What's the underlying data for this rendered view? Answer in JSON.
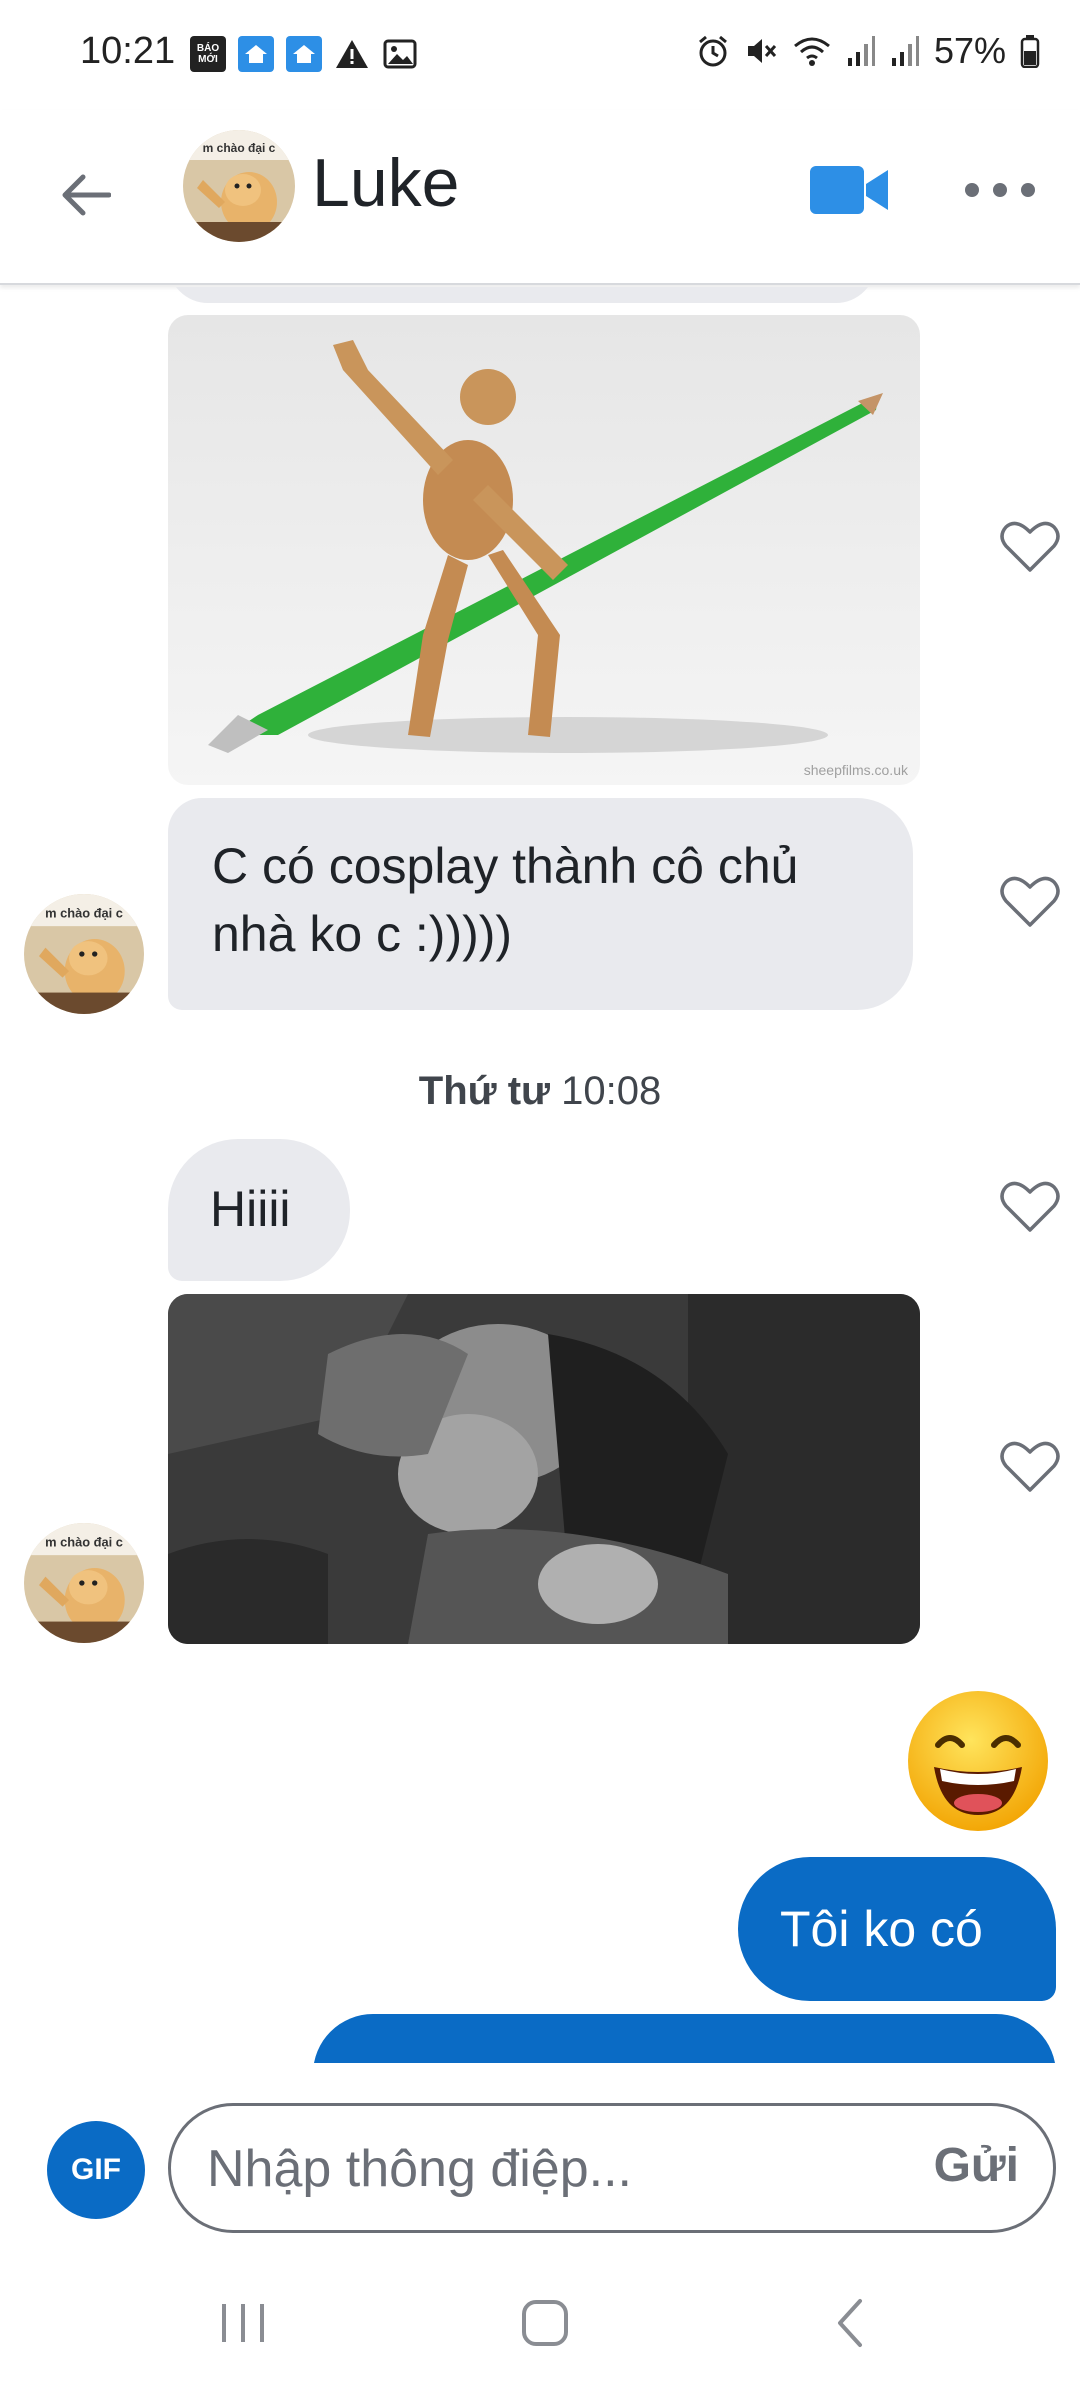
{
  "status_bar": {
    "time": "10:21",
    "baomoi_label": "BÁO MỚI",
    "battery": "57%",
    "icons": [
      "baomoi-app-icon",
      "home-notification-icon",
      "home-notification-icon",
      "warning-icon",
      "image-icon",
      "alarm-icon",
      "mute-icon",
      "wifi-icon",
      "signal-icon",
      "signal-icon",
      "battery-icon"
    ]
  },
  "header": {
    "contact_name": "Luke",
    "avatar_caption": "m chào đại c",
    "icons": [
      "back-arrow-icon",
      "video-call-icon",
      "more-icon"
    ]
  },
  "messages": {
    "msg1_text": "C có cosplay thành cô chủ nhà ko c :)))))",
    "timestamp_day": "Thứ tư",
    "timestamp_time": "10:08",
    "msg2_text": "Hiiii",
    "sent_emoji": "😄",
    "sent_text": "Tôi ko có",
    "image_watermark": "sheepfilms.co.uk"
  },
  "composer": {
    "gif_label": "GIF",
    "input_placeholder": "Nhập thông điệp...",
    "send_label": "Gửi"
  },
  "colors": {
    "accent": "#0a6bc5",
    "incoming_bubble": "#e9eaee",
    "muted_text": "#6b6f77"
  },
  "nav_bar": {
    "icons": [
      "recent-apps-icon",
      "home-icon",
      "back-icon"
    ]
  }
}
